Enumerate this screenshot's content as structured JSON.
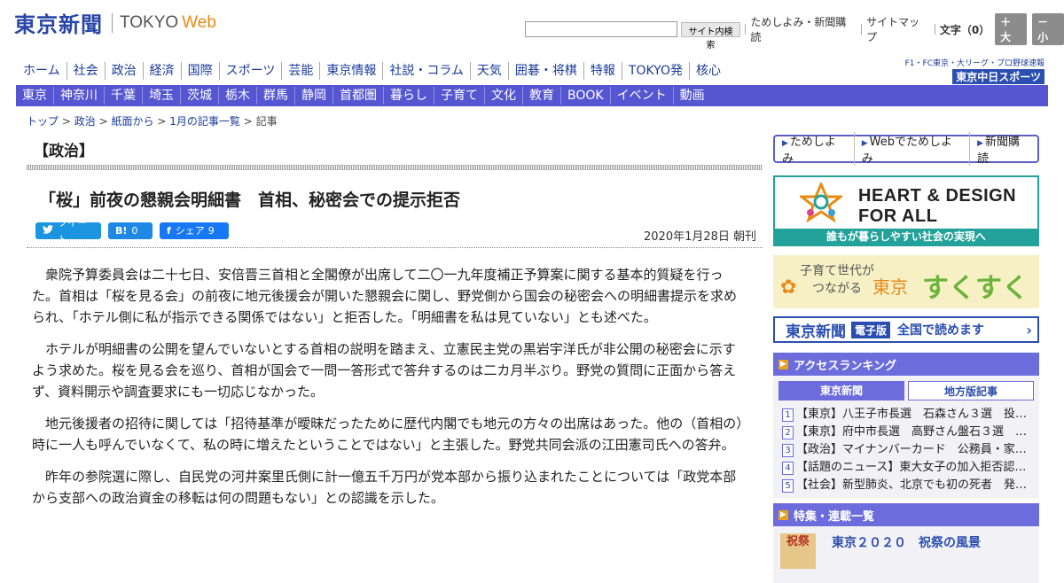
{
  "header": {
    "logo_kanji": "東京新聞",
    "logo_tokyo": "TOKYO",
    "logo_web": "Web",
    "search_button": "サイト内検索",
    "links": [
      "ためしよみ・新聞購読",
      "サイトマップ"
    ],
    "font_size_label": "文字（0）",
    "font_bigger": "＋大",
    "font_smaller": "－小"
  },
  "main_nav": [
    "ホーム",
    "社会",
    "政治",
    "経済",
    "国際",
    "スポーツ",
    "芸能",
    "東京情報",
    "社説・コラム",
    "天気",
    "囲碁・将棋",
    "特報",
    "TOKYO発",
    "核心"
  ],
  "chunichi": {
    "tagline": "F1・FC東京・大リーグ・プロ野球速報",
    "logo": "東京中日スポーツ"
  },
  "sub_nav": [
    "東京",
    "神奈川",
    "千葉",
    "埼玉",
    "茨城",
    "栃木",
    "群馬",
    "静岡",
    "首都圏",
    "暮らし",
    "子育て",
    "文化",
    "教育",
    "BOOK",
    "イベント",
    "動画"
  ],
  "breadcrumb": [
    "トップ",
    "政治",
    "紙面から",
    "1月の記事一覧",
    "記事"
  ],
  "breadcrumb_sep": ">",
  "article": {
    "section": "【政治】",
    "headline": "「桜」前夜の懇親会明細書　首相、秘密会での提示拒否",
    "share": {
      "tweet": "ツイート",
      "hatena_icon": "B!",
      "hatena_count": "0",
      "fb_icon": "f",
      "fb_label": "シェア",
      "fb_count": "9"
    },
    "date": "2020年1月28日 朝刊",
    "paragraphs": [
      "衆院予算委員会は二十七日、安倍晋三首相と全閣僚が出席して二〇一九年度補正予算案に関する基本的質疑を行った。首相は「桜を見る会」の前夜に地元後援会が開いた懇親会に関し、野党側から国会の秘密会への明細書提示を求められ、「ホテル側に私が指示できる関係ではない」と拒否した。「明細書を私は見ていない」とも述べた。",
      "ホテルが明細書の公開を望んでいないとする首相の説明を踏まえ、立憲民主党の黒岩宇洋氏が非公開の秘密会に示すよう求めた。桜を見る会を巡り、首相が国会で一問一答形式で答弁するのは二カ月半ぶり。野党の質問に正面から答えず、資料開示や調査要求にも一切応じなかった。",
      "地元後援者の招待に関しては「招待基準が曖昧だったために歴代内閣でも地元の方々の出席はあった。他の（首相の）時に一人も呼んでいなくて、私の時に増えたということではない」と主張した。野党共同会派の江田憲司氏への答弁。",
      "昨年の参院選に際し、自民党の河井案里氏側に計一億五千万円が党本部から振り込まれたことについては「政党本部から支部への政治資金の移転は何の問題もない」との認識を示した。"
    ]
  },
  "sidebar": {
    "tameshi": [
      "ためしよみ",
      "Webでためしよみ",
      "新聞購読"
    ],
    "heart": {
      "title_line1": "HEART & DESIGN",
      "title_line2": "FOR ALL",
      "sub": "誰もが暮らしやすい社会の実現へ"
    },
    "sukusuku": {
      "small_line1": "子育て世代が",
      "small_line2": "つながる",
      "tokyo": "東京",
      "big": "すくすく"
    },
    "epaper": {
      "logo": "東京新聞",
      "badge": "電子版",
      "text": "全国で読めます",
      "chevron": "›"
    },
    "ranking": {
      "title": "アクセスランキング",
      "tabs": [
        "東京新聞",
        "地方版記事"
      ],
      "items": [
        "【東京】八王子市長選　石森さん３選　投…",
        "【東京】府中市長選　高野さん盤石３選　…",
        "【政治】マイナンバーカード　公務員・家…",
        "【話題のニュース】東大女子の加入拒否認…",
        "【社会】新型肺炎、北京でも初の死者　発…"
      ]
    },
    "feature": {
      "title": "特集・連載一覧",
      "item_title": "東京２０２０　祝祭の風景",
      "thumb_text": "祝祭"
    }
  },
  "colors": {
    "brand_blue": "#2846a7",
    "nav_purple": "#5656d3",
    "accent_orange": "#e98b12",
    "teal": "#22a29a"
  }
}
